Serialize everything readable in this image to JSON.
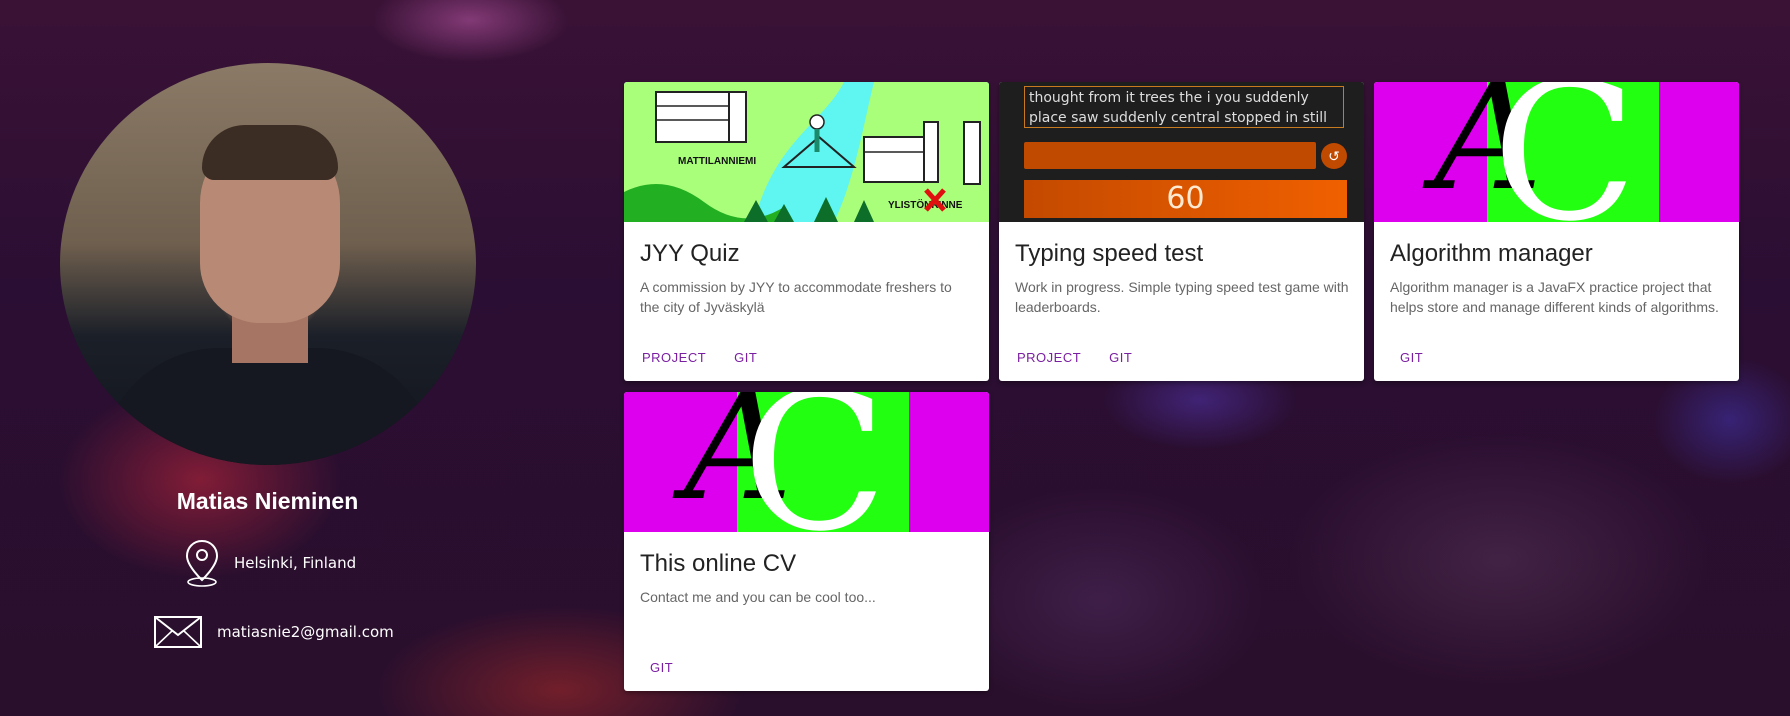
{
  "profile": {
    "name": "Matias Nieminen",
    "location": "Helsinki, Finland",
    "email": "matiasnie2@gmail.com"
  },
  "projects": [
    {
      "title": "JYY Quiz",
      "description": "A commission by JYY to accommodate freshers to the city of Jyväskylä",
      "actions": [
        "PROJECT",
        "GIT"
      ],
      "image": {
        "type": "map-illustration",
        "labels": [
          "MATTILANNIEMI",
          "YLISTÖNRINNE"
        ]
      }
    },
    {
      "title": "Typing speed test",
      "description": "Work in progress. Simple typing speed test game with leaderboards.",
      "actions": [
        "PROJECT",
        "GIT"
      ],
      "image": {
        "type": "typing-screenshot",
        "line1": "thought from it trees the i you suddenly",
        "line2": "place saw suddenly central stopped in still",
        "timer": "60"
      }
    },
    {
      "title": "Algorithm manager",
      "description": "Algorithm manager is a JavaFX practice project that helps store and manage different kinds of algorithms.",
      "actions": [
        "GIT"
      ],
      "image": {
        "type": "ac-logo",
        "letter_a": "A",
        "letter_c": "C"
      }
    },
    {
      "title": "This online CV",
      "description": "Contact me and you can be cool too...",
      "actions": [
        "GIT"
      ],
      "image": {
        "type": "ac-logo",
        "letter_a": "A",
        "letter_c": "C"
      }
    }
  ],
  "colors": {
    "accent": "#7b1fa2",
    "magenta": "#dd00ee",
    "green": "#22ff11",
    "typing_orange": "#e05a00"
  }
}
